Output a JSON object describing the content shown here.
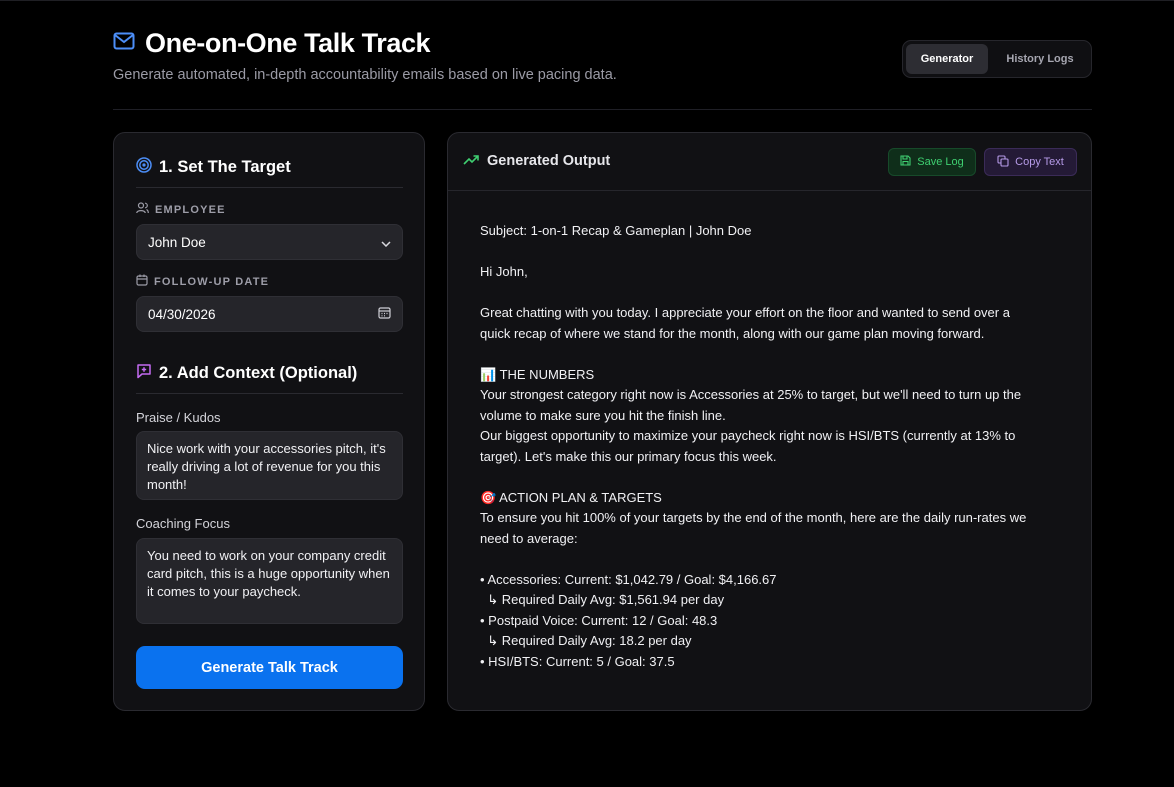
{
  "header": {
    "title": "One-on-One Talk Track",
    "subtitle": "Generate automated, in-depth accountability emails based on live pacing data.",
    "icon": "mail-icon"
  },
  "tabs": [
    {
      "label": "Generator",
      "active": true
    },
    {
      "label": "History Logs",
      "active": false
    }
  ],
  "left": {
    "section1": "1. Set The Target",
    "employee_label": "EMPLOYEE",
    "employee_value": "John Doe",
    "date_label": "FOLLOW-UP DATE",
    "date_value": "04/30/2026",
    "section2": "2. Add Context (Optional)",
    "praise_label": "Praise / Kudos",
    "praise_text": "Nice work with your accessories pitch, it's really driving a lot of revenue for you this month!",
    "coaching_label": "Coaching Focus",
    "coaching_text": "You need to work on your company credit card pitch, this is a huge opportunity when it comes to your paycheck.",
    "generate_label": "Generate Talk Track"
  },
  "output": {
    "title": "Generated Output",
    "save_label": "Save Log",
    "copy_label": "Copy Text",
    "email_lines": [
      "Subject: 1-on-1 Recap & Gameplan | John Doe",
      "",
      "Hi John,",
      "",
      "Great chatting with you today. I appreciate your effort on the floor and wanted to send over a",
      "quick recap of where we stand for the month, along with our game plan moving forward.",
      "",
      "📊 THE NUMBERS",
      "Your strongest category right now is Accessories at 25% to target, but we'll need to turn up the",
      "volume to make sure you hit the finish line.",
      "Our biggest opportunity to maximize your paycheck right now is HSI/BTS (currently at 13% to",
      "target). Let's make this our primary focus this week.",
      "",
      "🎯 ACTION PLAN & TARGETS",
      "To ensure you hit 100% of your targets by the end of the month, here are the daily run-rates we",
      "need to average:",
      "",
      "• Accessories: Current: $1,042.79 / Goal: $4,166.67",
      "  ↳ Required Daily Avg: $1,561.94 per day",
      "• Postpaid Voice: Current: 12 / Goal: 48.3",
      "  ↳ Required Daily Avg: 18.2 per day",
      "• HSI/BTS: Current: 5 / Goal: 37.5"
    ]
  },
  "colors": {
    "accent_blue": "#0a72ef",
    "save_green": "#3fcf71",
    "copy_purple": "#b69be8"
  }
}
